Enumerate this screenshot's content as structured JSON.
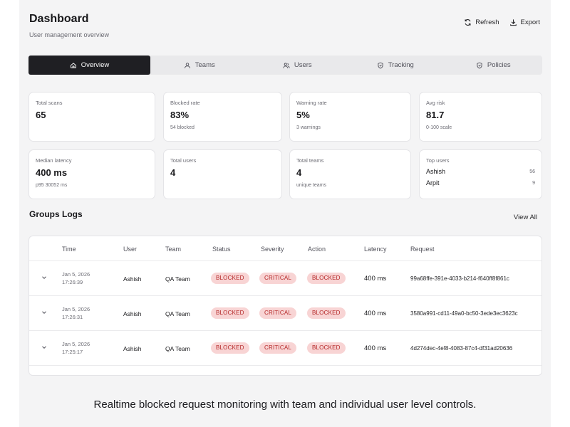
{
  "header": {
    "title": "Dashboard",
    "subtitle": "User management overview",
    "refresh_label": "Refresh",
    "export_label": "Export"
  },
  "tabs": [
    {
      "label": "Overview",
      "icon": "home-icon",
      "active": true
    },
    {
      "label": "Teams",
      "icon": "user-icon",
      "active": false
    },
    {
      "label": "Users",
      "icon": "users-icon",
      "active": false
    },
    {
      "label": "Tracking",
      "icon": "shield-icon",
      "active": false
    },
    {
      "label": "Policies",
      "icon": "shield-icon",
      "active": false
    }
  ],
  "stats": {
    "total_scans": {
      "label": "Total scans",
      "value": "65"
    },
    "blocked_rate": {
      "label": "Blocked rate",
      "value": "83%",
      "sub": "54 blocked"
    },
    "warning_rate": {
      "label": "Warning rate",
      "value": "5%",
      "sub": "3 warnings"
    },
    "avg_risk": {
      "label": "Avg risk",
      "value": "81.7",
      "sub": "0-100 scale"
    },
    "median_latency": {
      "label": "Median latency",
      "value": "400 ms",
      "sub": "p95 30052 ms"
    },
    "total_users": {
      "label": "Total users",
      "value": "4"
    },
    "total_teams": {
      "label": "Total teams",
      "value": "4",
      "sub": "unique teams"
    },
    "top_users": {
      "label": "Top users",
      "items": [
        {
          "name": "Ashish",
          "count": "56"
        },
        {
          "name": "Arpit",
          "count": "9"
        }
      ]
    }
  },
  "logs": {
    "title": "Groups Logs",
    "view_all": "View All",
    "columns": [
      "Time",
      "User",
      "Team",
      "Status",
      "Severity",
      "Action",
      "Latency",
      "Request"
    ],
    "rows": [
      {
        "date": "Jan 5, 2026",
        "time": "17:26:39",
        "user": "Ashish",
        "team": "QA Team",
        "status": "BLOCKED",
        "severity": "CRITICAL",
        "action": "BLOCKED",
        "latency": "400 ms",
        "request": "99a68ffe-391e-4033-b214-f640ff8f861c"
      },
      {
        "date": "Jan 5, 2026",
        "time": "17:26:31",
        "user": "Ashish",
        "team": "QA Team",
        "status": "BLOCKED",
        "severity": "CRITICAL",
        "action": "BLOCKED",
        "latency": "400 ms",
        "request": "3580a991-cd11-49a0-bc50-3ede3ec3623c"
      },
      {
        "date": "Jan 5, 2026",
        "time": "17:25:17",
        "user": "Ashish",
        "team": "QA Team",
        "status": "BLOCKED",
        "severity": "CRITICAL",
        "action": "BLOCKED",
        "latency": "400 ms",
        "request": "4d274dec-4ef8-4083-87c4-df31ad20636"
      }
    ]
  },
  "caption": "Realtime blocked request monitoring with team and individual user level controls.",
  "colors": {
    "active_tab": "#1f1f23",
    "badge_bg": "#f8d4d4",
    "badge_text": "#b42626"
  }
}
